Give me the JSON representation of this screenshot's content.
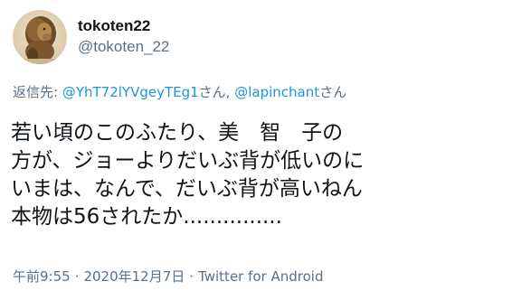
{
  "author": {
    "display_name": "tokoten22",
    "handle": "@tokoten_22",
    "avatar_icon": "lion-photo-avatar"
  },
  "reply": {
    "prefix": "返信先: ",
    "mention1": "@YhT72lYVgeyTEg1",
    "suffix1": "さん, ",
    "mention2": "@lapinchant",
    "suffix2": "さん"
  },
  "tweet": {
    "lines": [
      "若い頃のこのふたり、美　智　子の",
      "方が、ジョーよりだいぶ背が低いのに",
      "いまは、なんで、だいぶ背が高いねん",
      "本物は56されたか..............."
    ]
  },
  "meta": {
    "time": "午前9:55",
    "separator1": "·",
    "date": "2020年12月7日",
    "separator2": "·",
    "source": "Twitter for Android"
  },
  "colors": {
    "text": "#0f1419",
    "secondary": "#5b7083",
    "link": "#1b95e0"
  }
}
